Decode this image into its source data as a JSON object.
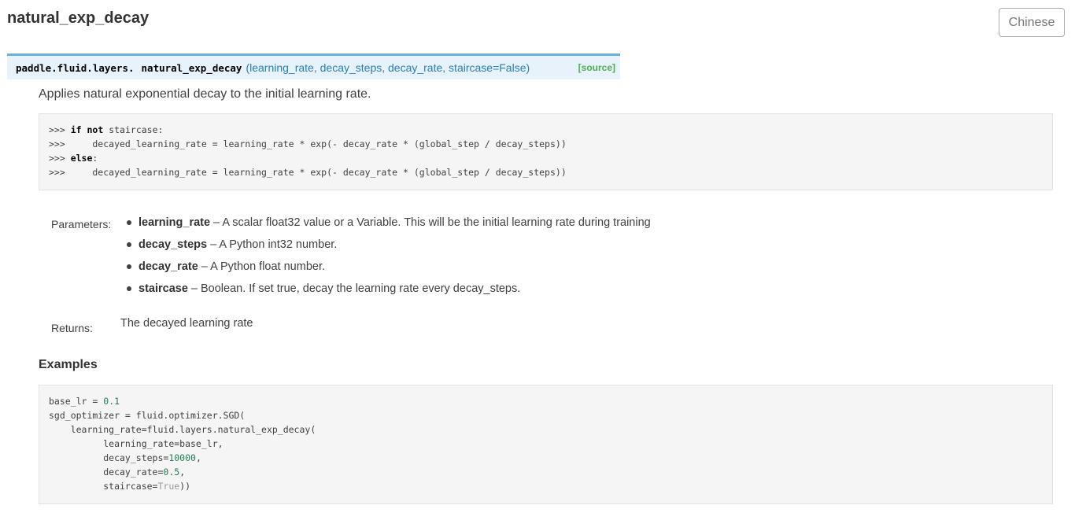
{
  "page": {
    "title": "natural_exp_decay",
    "language_button": "Chinese"
  },
  "signature": {
    "module": "paddle.fluid.layers.",
    "name": "natural_exp_decay",
    "params": "(learning_rate, decay_steps, decay_rate, staircase=False)",
    "source_link": "[source]"
  },
  "description": "Applies natural exponential decay to the initial learning rate.",
  "formula_code": [
    [
      {
        "t": ">>> ",
        "c": ""
      },
      {
        "t": "if",
        "c": "kw"
      },
      {
        "t": " ",
        "c": ""
      },
      {
        "t": "not",
        "c": "kw"
      },
      {
        "t": " staircase:",
        "c": ""
      }
    ],
    [
      {
        "t": ">>>     decayed_learning_rate = learning_rate * exp(- decay_rate * (global_step / decay_steps))",
        "c": ""
      }
    ],
    [
      {
        "t": ">>> ",
        "c": ""
      },
      {
        "t": "else",
        "c": "kw"
      },
      {
        "t": ":",
        "c": ""
      }
    ],
    [
      {
        "t": ">>>     decayed_learning_rate = learning_rate * exp(- decay_rate * (global_step / decay_steps))",
        "c": ""
      }
    ]
  ],
  "parameters": {
    "label": "Parameters:",
    "items": [
      {
        "name": "learning_rate",
        "desc": " – A scalar float32 value or a Variable. This will be the initial learning rate during training"
      },
      {
        "name": "decay_steps",
        "desc": " – A Python int32 number."
      },
      {
        "name": "decay_rate",
        "desc": " – A Python float number."
      },
      {
        "name": "staircase",
        "desc": " – Boolean. If set true, decay the learning rate every decay_steps."
      }
    ]
  },
  "returns": {
    "label": "Returns:",
    "value": "The decayed learning rate"
  },
  "examples": {
    "heading": "Examples",
    "code": [
      [
        {
          "t": "base_lr = ",
          "c": ""
        },
        {
          "t": "0.1",
          "c": "num"
        }
      ],
      [
        {
          "t": "sgd_optimizer = fluid.optimizer.SGD(",
          "c": ""
        }
      ],
      [
        {
          "t": "    learning_rate=fluid.layers.natural_exp_decay(",
          "c": ""
        }
      ],
      [
        {
          "t": "          learning_rate=base_lr,",
          "c": ""
        }
      ],
      [
        {
          "t": "          decay_steps=",
          "c": ""
        },
        {
          "t": "10000",
          "c": "num"
        },
        {
          "t": ",",
          "c": ""
        }
      ],
      [
        {
          "t": "          decay_rate=",
          "c": ""
        },
        {
          "t": "0.5",
          "c": "num"
        },
        {
          "t": ",",
          "c": ""
        }
      ],
      [
        {
          "t": "          staircase=",
          "c": ""
        },
        {
          "t": "True",
          "c": "const"
        },
        {
          "t": "))",
          "c": ""
        }
      ]
    ]
  },
  "colors": {
    "signature_bg": "#e7f2fa",
    "signature_border": "#6ab0de",
    "param_link": "#2980b9",
    "source_link": "#4caf50",
    "code_bg": "#f5f5f5",
    "number": "#208050"
  }
}
